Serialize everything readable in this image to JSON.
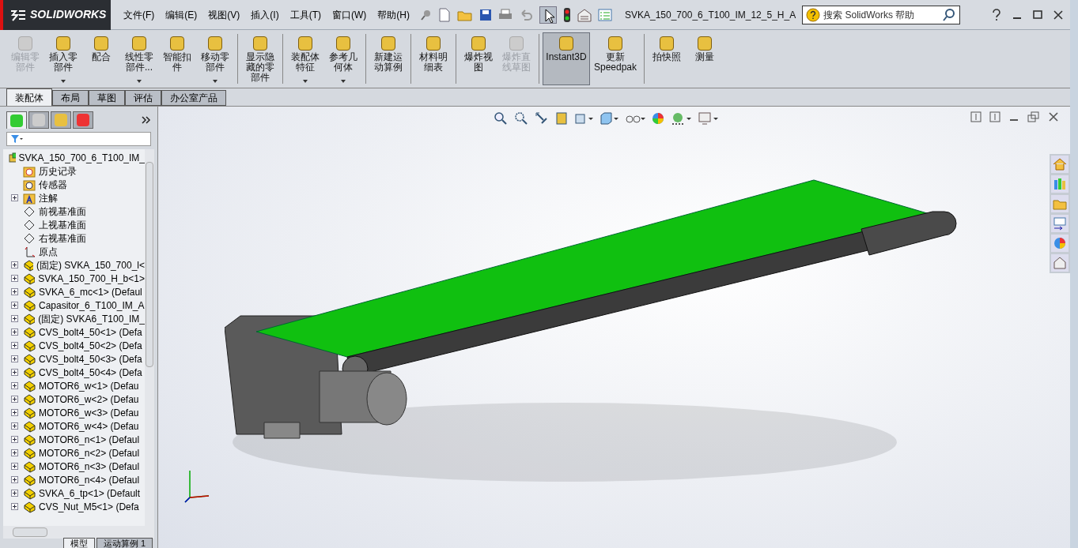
{
  "app": {
    "logo": "SOLIDWORKS",
    "menu": [
      "文件(F)",
      "编辑(E)",
      "视图(V)",
      "插入(I)",
      "工具(T)",
      "窗口(W)",
      "帮助(H)"
    ],
    "document_title": "SVKA_150_700_6_T100_IM_12_5_H_A",
    "search": {
      "placeholder": "搜索 SolidWorks 帮助"
    }
  },
  "command_groups": [
    [
      {
        "label": "编辑零部件",
        "disabled": true,
        "has_menu": false,
        "selected": false
      },
      {
        "label": "插入零部件",
        "disabled": false,
        "has_menu": true,
        "selected": false
      },
      {
        "label": "配合",
        "disabled": false,
        "has_menu": false,
        "selected": false
      },
      {
        "label": "线性零部件...",
        "disabled": false,
        "has_menu": true,
        "selected": false
      },
      {
        "label": "智能扣件",
        "disabled": false,
        "has_menu": false,
        "selected": false
      },
      {
        "label": "移动零部件",
        "disabled": false,
        "has_menu": true,
        "selected": false
      }
    ],
    [
      {
        "label": "显示隐藏的零部件",
        "disabled": false,
        "has_menu": false,
        "selected": false
      }
    ],
    [
      {
        "label": "装配体特征",
        "disabled": false,
        "has_menu": true,
        "selected": false
      },
      {
        "label": "参考几何体",
        "disabled": false,
        "has_menu": true,
        "selected": false
      }
    ],
    [
      {
        "label": "新建运动算例",
        "disabled": false,
        "has_menu": false,
        "selected": false
      }
    ],
    [
      {
        "label": "材料明细表",
        "disabled": false,
        "has_menu": false,
        "selected": false
      }
    ],
    [
      {
        "label": "爆炸视图",
        "disabled": false,
        "has_menu": false,
        "selected": false
      },
      {
        "label": "爆炸直线草图",
        "disabled": true,
        "has_menu": false,
        "selected": false
      }
    ],
    [
      {
        "label": "Instant3D",
        "disabled": false,
        "has_menu": false,
        "selected": true
      },
      {
        "label": "更新Speedpak",
        "disabled": false,
        "has_menu": false,
        "selected": false
      }
    ],
    [
      {
        "label": "拍快照",
        "disabled": false,
        "has_menu": false,
        "selected": false
      },
      {
        "label": "测量",
        "disabled": false,
        "has_menu": false,
        "selected": false
      }
    ]
  ],
  "tabs": [
    {
      "label": "装配体",
      "selected": true
    },
    {
      "label": "布局",
      "selected": false
    },
    {
      "label": "草图",
      "selected": false
    },
    {
      "label": "评估",
      "selected": false
    },
    {
      "label": "办公室产品",
      "selected": false
    }
  ],
  "panel_tabs": [
    {
      "selected": true
    },
    {
      "selected": false
    },
    {
      "selected": false
    },
    {
      "selected": false
    }
  ],
  "tree": {
    "root": "SVKA_150_700_6_T100_IM_",
    "children": [
      {
        "label": "历史记录",
        "kind": "history",
        "expandable": false
      },
      {
        "label": "传感器",
        "kind": "sensor",
        "expandable": false
      },
      {
        "label": "注解",
        "kind": "annotation",
        "expandable": true
      },
      {
        "label": "前视基准面",
        "kind": "plane",
        "expandable": false
      },
      {
        "label": "上视基准面",
        "kind": "plane",
        "expandable": false
      },
      {
        "label": "右视基准面",
        "kind": "plane",
        "expandable": false
      },
      {
        "label": "原点",
        "kind": "origin",
        "expandable": false
      },
      {
        "label": "(固定) SVKA_150_700_l<",
        "kind": "part",
        "expandable": true
      },
      {
        "label": "SVKA_150_700_H_b<1>",
        "kind": "part",
        "expandable": true
      },
      {
        "label": "SVKA_6_mc<1> (Defaul",
        "kind": "part",
        "expandable": true
      },
      {
        "label": "Capasitor_6_T100_IM_A",
        "kind": "part",
        "expandable": true
      },
      {
        "label": "(固定) SVKA6_T100_IM_",
        "kind": "part",
        "expandable": true
      },
      {
        "label": "CVS_bolt4_50<1> (Defa",
        "kind": "part",
        "expandable": true
      },
      {
        "label": "CVS_bolt4_50<2> (Defa",
        "kind": "part",
        "expandable": true
      },
      {
        "label": "CVS_bolt4_50<3> (Defa",
        "kind": "part",
        "expandable": true
      },
      {
        "label": "CVS_bolt4_50<4> (Defa",
        "kind": "part",
        "expandable": true
      },
      {
        "label": "MOTOR6_w<1> (Defau",
        "kind": "part",
        "expandable": true
      },
      {
        "label": "MOTOR6_w<2> (Defau",
        "kind": "part",
        "expandable": true
      },
      {
        "label": "MOTOR6_w<3> (Defau",
        "kind": "part",
        "expandable": true
      },
      {
        "label": "MOTOR6_w<4> (Defau",
        "kind": "part",
        "expandable": true
      },
      {
        "label": "MOTOR6_n<1> (Defaul",
        "kind": "part",
        "expandable": true
      },
      {
        "label": "MOTOR6_n<2> (Defaul",
        "kind": "part",
        "expandable": true
      },
      {
        "label": "MOTOR6_n<3> (Defaul",
        "kind": "part",
        "expandable": true
      },
      {
        "label": "MOTOR6_n<4> (Defaul",
        "kind": "part",
        "expandable": true
      },
      {
        "label": "SVKA_6_tp<1> (Default",
        "kind": "part",
        "expandable": true
      },
      {
        "label": "CVS_Nut_M5<1> (Defa",
        "kind": "part",
        "expandable": true
      }
    ]
  },
  "bottom_tabs": [
    {
      "label": "模型",
      "selected": true
    },
    {
      "label": "运动算例 1",
      "selected": false
    }
  ]
}
